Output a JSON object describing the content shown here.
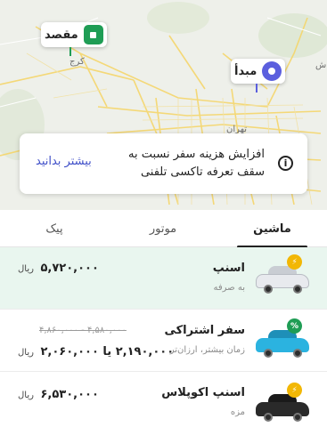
{
  "map": {
    "destination_label": "مقصد",
    "origin_label": "مبدأ",
    "place_karaj": "کرج",
    "place_tehran": "تهران",
    "place_mashhad_label": "ش",
    "colors": {
      "destination": "#1f9d55",
      "origin": "#5b5fde"
    }
  },
  "notice": {
    "text": "افزایش هزینه سفر نسبت به سقف تعرفه تاکسی تلفنی",
    "link": "بیشتر بدانید",
    "icon": "info-icon"
  },
  "tabs": [
    {
      "label": "ماشین",
      "active": true
    },
    {
      "label": "موتور",
      "active": false
    },
    {
      "label": "پیک",
      "active": false
    }
  ],
  "services": [
    {
      "name": "اسنپ",
      "subtitle": "به صرفه",
      "price": "۵,۷۲۰,۰۰۰",
      "unit": "ریال",
      "selected": true,
      "badge_icon": "lightning-icon",
      "car_color": "#e8eaee"
    },
    {
      "name": "سفر اشتراکی",
      "subtitle": "زمان بیشتر، ارزان‌تر",
      "old_price": "۴,۵۸۰,۰۰۰ - ۴,۸۶۰,۰۰۰",
      "price": "۲,۱۹۰,۰۰۰ یا ۲,۰۶۰,۰۰۰",
      "unit": "ریال",
      "selected": false,
      "badge_icon": "percent-icon",
      "car_color": "#2bb3e0"
    },
    {
      "name": "اسنپ اکوپلاس",
      "subtitle": "مزه",
      "price": "۶,۵۳۰,۰۰۰",
      "unit": "ریال",
      "selected": false,
      "badge_icon": "lightning-icon",
      "car_color": "#2a2a2a"
    }
  ]
}
